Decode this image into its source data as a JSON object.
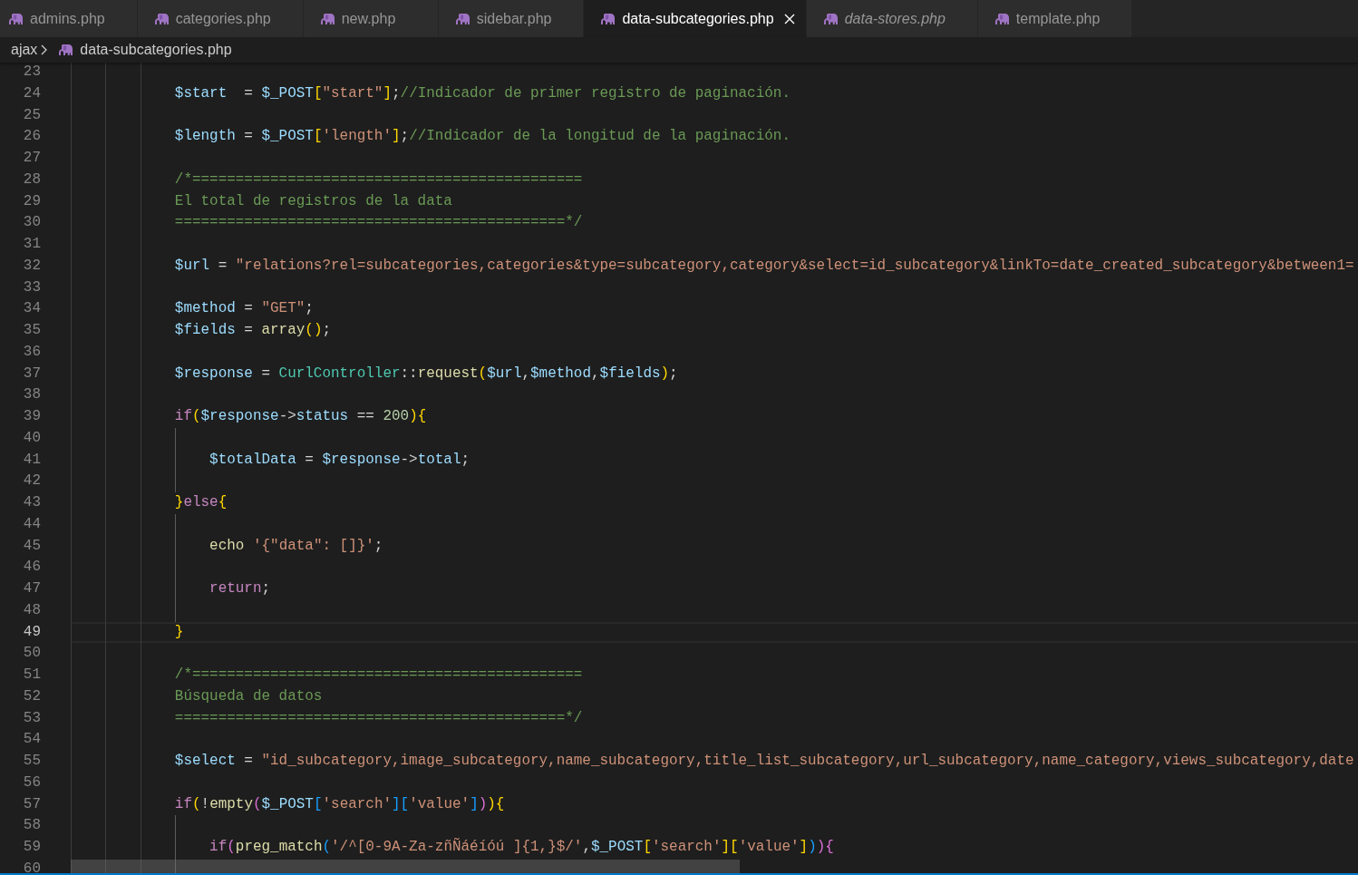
{
  "tabs": [
    {
      "label": "admins.php",
      "selected": false,
      "preview": false
    },
    {
      "label": "categories.php",
      "selected": false,
      "preview": false
    },
    {
      "label": "new.php",
      "selected": false,
      "preview": false
    },
    {
      "label": "sidebar.php",
      "selected": false,
      "preview": false
    },
    {
      "label": "data-subcategories.php",
      "selected": true,
      "preview": false
    },
    {
      "label": "data-stores.php",
      "selected": false,
      "preview": true
    },
    {
      "label": "template.php",
      "selected": false,
      "preview": false
    }
  ],
  "breadcrumb": [
    {
      "label": "ajax",
      "kind": "folder"
    },
    {
      "label": "data-subcategories.php",
      "kind": "file"
    }
  ],
  "editor": {
    "lines": [
      {
        "number": "23",
        "current": false
      },
      {
        "number": "24",
        "current": false,
        "tokens": [
          {
            "text": "$start",
            "kind": "variable"
          },
          {
            "text": "  = ",
            "kind": "operator"
          },
          {
            "text": "$_POST",
            "kind": "variable"
          },
          {
            "text": "[",
            "kind": "bracket1"
          },
          {
            "text": "\"start\"",
            "kind": "string"
          },
          {
            "text": "]",
            "kind": "bracket1"
          },
          {
            "text": ";",
            "kind": "operator"
          },
          {
            "text": "//Indicador de primer registro de paginación.",
            "kind": "comment"
          }
        ]
      },
      {
        "number": "25",
        "current": false
      },
      {
        "number": "26",
        "current": false,
        "tokens": [
          {
            "text": "$length",
            "kind": "variable"
          },
          {
            "text": " = ",
            "kind": "operator"
          },
          {
            "text": "$_POST",
            "kind": "variable"
          },
          {
            "text": "[",
            "kind": "bracket1"
          },
          {
            "text": "'length'",
            "kind": "string"
          },
          {
            "text": "]",
            "kind": "bracket1"
          },
          {
            "text": ";",
            "kind": "operator"
          },
          {
            "text": "//Indicador de la longitud de la paginación.",
            "kind": "comment"
          }
        ]
      },
      {
        "number": "27",
        "current": false
      },
      {
        "number": "28",
        "current": false,
        "tokens": [
          {
            "text": "/*=============================================",
            "kind": "comment"
          }
        ]
      },
      {
        "number": "29",
        "current": false,
        "tokens": [
          {
            "text": "El total de registros de la data",
            "kind": "comment"
          }
        ]
      },
      {
        "number": "30",
        "current": false,
        "tokens": [
          {
            "text": "=============================================*/",
            "kind": "comment"
          }
        ]
      },
      {
        "number": "31",
        "current": false
      },
      {
        "number": "32",
        "current": false,
        "tokens": [
          {
            "text": "$url",
            "kind": "variable"
          },
          {
            "text": " = ",
            "kind": "operator"
          },
          {
            "text": "\"relations?rel=subcategories,categories&type=subcategory,category&select=id_subcategory&linkTo=date_created_subcategory&between1=",
            "kind": "string"
          }
        ]
      },
      {
        "number": "33",
        "current": false
      },
      {
        "number": "34",
        "current": false,
        "tokens": [
          {
            "text": "$method",
            "kind": "variable"
          },
          {
            "text": " = ",
            "kind": "operator"
          },
          {
            "text": "\"GET\"",
            "kind": "string"
          },
          {
            "text": ";",
            "kind": "operator"
          }
        ]
      },
      {
        "number": "35",
        "current": false,
        "tokens": [
          {
            "text": "$fields",
            "kind": "variable"
          },
          {
            "text": " = ",
            "kind": "operator"
          },
          {
            "text": "array",
            "kind": "function"
          },
          {
            "text": "()",
            "kind": "bracket1"
          },
          {
            "text": ";",
            "kind": "operator"
          }
        ]
      },
      {
        "number": "36",
        "current": false
      },
      {
        "number": "37",
        "current": false,
        "tokens": [
          {
            "text": "$response",
            "kind": "variable"
          },
          {
            "text": " = ",
            "kind": "operator"
          },
          {
            "text": "CurlController",
            "kind": "class"
          },
          {
            "text": "::",
            "kind": "operator"
          },
          {
            "text": "request",
            "kind": "function"
          },
          {
            "text": "(",
            "kind": "bracket1"
          },
          {
            "text": "$url",
            "kind": "variable"
          },
          {
            "text": ",",
            "kind": "operator"
          },
          {
            "text": "$method",
            "kind": "variable"
          },
          {
            "text": ",",
            "kind": "operator"
          },
          {
            "text": "$fields",
            "kind": "variable"
          },
          {
            "text": ")",
            "kind": "bracket1"
          },
          {
            "text": ";",
            "kind": "operator"
          }
        ]
      },
      {
        "number": "38",
        "current": false
      },
      {
        "number": "39",
        "current": false,
        "tokens": [
          {
            "text": "if",
            "kind": "keyword"
          },
          {
            "text": "(",
            "kind": "bracket1"
          },
          {
            "text": "$response",
            "kind": "variable"
          },
          {
            "text": "->",
            "kind": "operator"
          },
          {
            "text": "status",
            "kind": "variable"
          },
          {
            "text": " == ",
            "kind": "operator"
          },
          {
            "text": "200",
            "kind": "number"
          },
          {
            "text": ")",
            "kind": "bracket1"
          },
          {
            "text": "{",
            "kind": "bracket1"
          }
        ],
        "children": [
          {
            "number": "40",
            "current": false
          },
          {
            "number": "41",
            "current": false,
            "tokens": [
              {
                "text": "$totalData",
                "kind": "variable"
              },
              {
                "text": " = ",
                "kind": "operator"
              },
              {
                "text": "$response",
                "kind": "variable"
              },
              {
                "text": "->",
                "kind": "operator"
              },
              {
                "text": "total",
                "kind": "variable"
              },
              {
                "text": ";",
                "kind": "operator"
              }
            ]
          },
          {
            "number": "42",
            "current": false
          }
        ]
      },
      {
        "number": "43",
        "current": false,
        "tokens": [
          {
            "text": "}",
            "kind": "bracket1"
          },
          {
            "text": "else",
            "kind": "keyword"
          },
          {
            "text": "{",
            "kind": "bracket1"
          }
        ],
        "children": [
          {
            "number": "44",
            "current": false
          },
          {
            "number": "45",
            "current": false,
            "tokens": [
              {
                "text": "echo ",
                "kind": "function"
              },
              {
                "text": "'{\"data\": []}'",
                "kind": "string"
              },
              {
                "text": ";",
                "kind": "operator"
              }
            ]
          },
          {
            "number": "46",
            "current": false
          },
          {
            "number": "47",
            "current": false,
            "tokens": [
              {
                "text": "return",
                "kind": "keyword"
              },
              {
                "text": ";",
                "kind": "operator"
              }
            ]
          },
          {
            "number": "48",
            "current": false
          }
        ]
      },
      {
        "number": "49",
        "current": true,
        "tokens": [
          {
            "text": "}",
            "kind": "bracket1"
          }
        ]
      },
      {
        "number": "50",
        "current": false
      },
      {
        "number": "51",
        "current": false,
        "tokens": [
          {
            "text": "/*=============================================",
            "kind": "comment"
          }
        ]
      },
      {
        "number": "52",
        "current": false,
        "tokens": [
          {
            "text": "Búsqueda de datos",
            "kind": "comment"
          }
        ]
      },
      {
        "number": "53",
        "current": false,
        "tokens": [
          {
            "text": "=============================================*/",
            "kind": "comment"
          }
        ]
      },
      {
        "number": "54",
        "current": false
      },
      {
        "number": "55",
        "current": false,
        "tokens": [
          {
            "text": "$select",
            "kind": "variable"
          },
          {
            "text": " = ",
            "kind": "operator"
          },
          {
            "text": "\"id_subcategory,image_subcategory,name_subcategory,title_list_subcategory,url_subcategory,name_category,views_subcategory,date",
            "kind": "string"
          }
        ]
      },
      {
        "number": "56",
        "current": false
      },
      {
        "number": "57",
        "current": false,
        "tokens": [
          {
            "text": "if",
            "kind": "keyword"
          },
          {
            "text": "(",
            "kind": "bracket1"
          },
          {
            "text": "!",
            "kind": "operator"
          },
          {
            "text": "empty",
            "kind": "function"
          },
          {
            "text": "(",
            "kind": "bracket2"
          },
          {
            "text": "$_POST",
            "kind": "variable"
          },
          {
            "text": "[",
            "kind": "bracket3"
          },
          {
            "text": "'search'",
            "kind": "string"
          },
          {
            "text": "]",
            "kind": "bracket3"
          },
          {
            "text": "[",
            "kind": "bracket3"
          },
          {
            "text": "'value'",
            "kind": "string"
          },
          {
            "text": "]",
            "kind": "bracket3"
          },
          {
            "text": ")",
            "kind": "bracket2"
          },
          {
            "text": ")",
            "kind": "bracket1"
          },
          {
            "text": "{",
            "kind": "bracket1"
          }
        ],
        "children": [
          {
            "number": "58",
            "current": false
          },
          {
            "number": "59",
            "current": false,
            "tokens": [
              {
                "text": "if",
                "kind": "keyword"
              },
              {
                "text": "(",
                "kind": "bracket2"
              },
              {
                "text": "preg_match",
                "kind": "function"
              },
              {
                "text": "(",
                "kind": "bracket3"
              },
              {
                "text": "'/^[0-9A-Za-zñÑáéíóú ]{1,}$/'",
                "kind": "string"
              },
              {
                "text": ",",
                "kind": "operator"
              },
              {
                "text": "$_POST",
                "kind": "variable"
              },
              {
                "text": "[",
                "kind": "bracket1"
              },
              {
                "text": "'search'",
                "kind": "string"
              },
              {
                "text": "]",
                "kind": "bracket1"
              },
              {
                "text": "[",
                "kind": "bracket1"
              },
              {
                "text": "'value'",
                "kind": "string"
              },
              {
                "text": "]",
                "kind": "bracket1"
              },
              {
                "text": ")",
                "kind": "bracket3"
              },
              {
                "text": ")",
                "kind": "bracket2"
              },
              {
                "text": "{",
                "kind": "bracket2"
              }
            ]
          },
          {
            "number": "60",
            "current": false
          }
        ]
      }
    ]
  }
}
